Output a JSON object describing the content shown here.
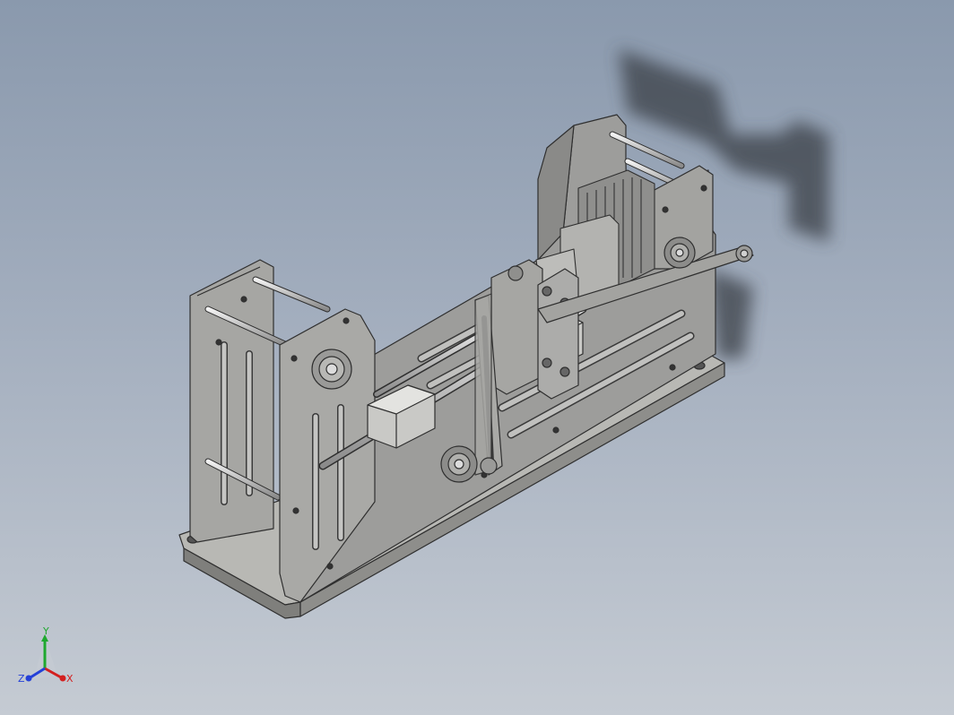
{
  "viewport": {
    "background_top": "#8a99ad",
    "background_bottom": "#c5cbd3"
  },
  "model": {
    "body_color": "#9c9c9a",
    "edge_color": "#2f2f2f",
    "shaft_color": "#d8d8d8",
    "shadow_color": "#3a3f47"
  },
  "view_cube_triad": {
    "labels": {
      "x": "X",
      "y": "Y",
      "z": "Z"
    },
    "colors": {
      "x": "#d32020",
      "y": "#1fa82f",
      "z": "#2440d8"
    }
  }
}
